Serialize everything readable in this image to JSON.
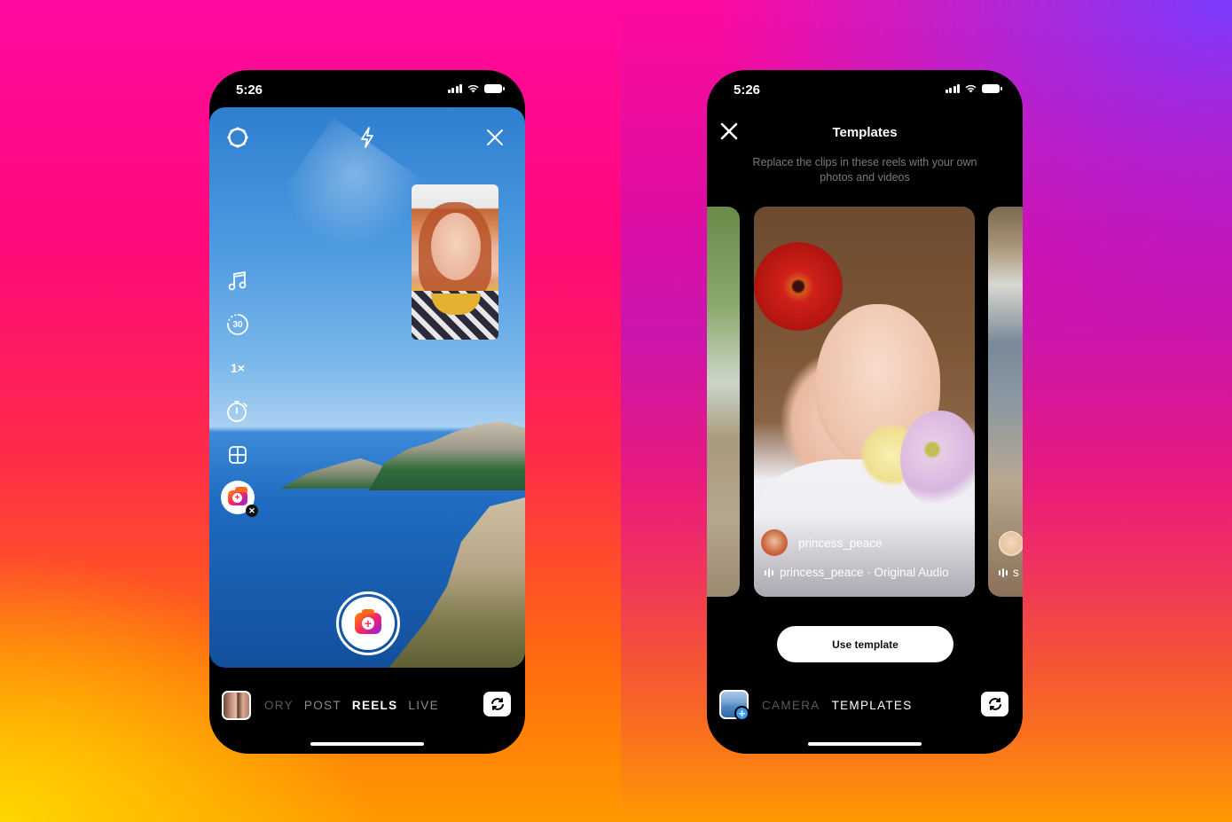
{
  "colors": {
    "background_gradient": [
      "#ff0aa0",
      "#ff2a4a",
      "#ff9a00",
      "#ffd600",
      "#7a3cff"
    ],
    "phone_bg": "#000000",
    "accent_gradient": [
      "#ff8a00",
      "#ff2d55",
      "#c81e9e",
      "#7b2fff"
    ],
    "gallery_plus": "#3a9af0"
  },
  "left_phone": {
    "status": {
      "time": "5:26",
      "signal_icon": "cellular-signal-icon",
      "wifi_icon": "wifi-icon",
      "battery_icon": "battery-icon"
    },
    "top_controls": {
      "settings_icon": "settings-gear-icon",
      "flash_icon": "flash-icon",
      "close_icon": "close-icon"
    },
    "side_tools": [
      {
        "name": "audio",
        "icon": "music-note-icon",
        "label": ""
      },
      {
        "name": "length",
        "icon": "timer-30-icon",
        "label": "30"
      },
      {
        "name": "speed",
        "icon": "speed-icon",
        "label": "1×"
      },
      {
        "name": "timer",
        "icon": "stopwatch-icon",
        "label": ""
      },
      {
        "name": "layout",
        "icon": "layout-grid-icon",
        "label": ""
      },
      {
        "name": "effects",
        "icon": "effect-camera-icon",
        "label": ""
      }
    ],
    "shutter_icon": "camera-plus-icon",
    "modes": [
      "ORY",
      "POST",
      "REELS",
      "LIVE"
    ],
    "active_mode": "REELS",
    "flip_icon": "flip-camera-icon"
  },
  "right_phone": {
    "status": {
      "time": "5:26"
    },
    "header": {
      "title": "Templates",
      "subtitle": "Replace the clips in these reels with your own photos and videos"
    },
    "cards": [
      {
        "position": "main",
        "creator": "princess_peace",
        "audio": "princess_peace · Original Audio"
      },
      {
        "position": "side-right",
        "audio": "s"
      }
    ],
    "use_template_label": "Use template",
    "modes": [
      "CAMERA",
      "TEMPLATES"
    ],
    "active_mode": "TEMPLATES"
  }
}
